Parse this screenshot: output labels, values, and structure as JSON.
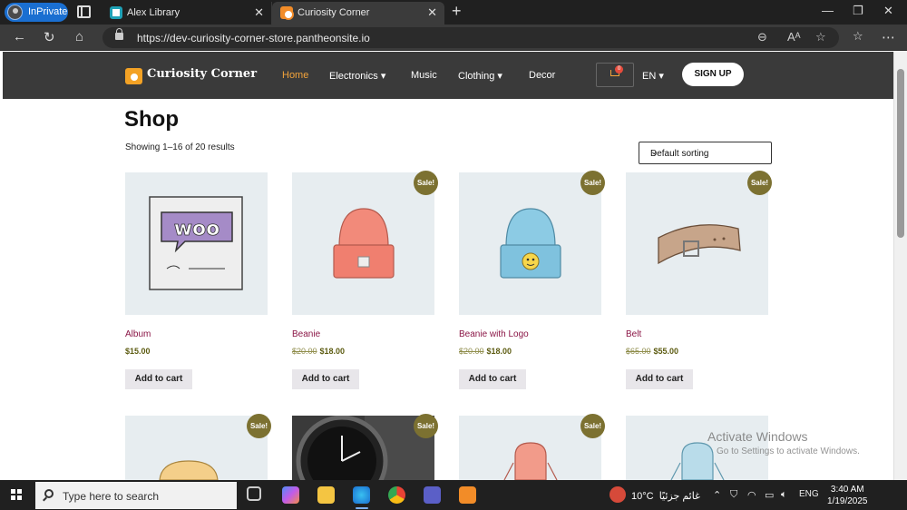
{
  "browser": {
    "inprivate_label": "InPrivate",
    "tabs": [
      {
        "title": "Alex Library",
        "active": false
      },
      {
        "title": "Curiosity Corner",
        "active": true
      }
    ],
    "url": "https://dev-curiosity-corner-store.pantheonsite.io"
  },
  "site": {
    "logo_text": "Curiosity Corner",
    "menu": [
      {
        "label": "Home",
        "active": true
      },
      {
        "label": "Electronics"
      },
      {
        "label": "Music"
      },
      {
        "label": "Clothing"
      },
      {
        "label": "Decor"
      }
    ],
    "cart_count": "0",
    "language": "EN",
    "signup_label": "SIGN UP",
    "brand_color": "#f2a33a",
    "header_bg": "#3a3a3a"
  },
  "shop": {
    "title": "Shop",
    "result_count": "Showing 1–16 of 20 results",
    "sorting": "Default sorting",
    "sale_label": "Sale!",
    "add_to_cart_label": "Add to cart",
    "products": [
      {
        "name": "Album",
        "price": "$15.00",
        "sale": false,
        "icon": "album-image"
      },
      {
        "name": "Beanie",
        "old_price": "$20.00",
        "price": "$18.00",
        "sale": true,
        "icon": "beanie-image"
      },
      {
        "name": "Beanie with Logo",
        "old_price": "$20.00",
        "price": "$18.00",
        "sale": true,
        "icon": "beanie-logo-image"
      },
      {
        "name": "Belt",
        "old_price": "$65.00",
        "price": "$55.00",
        "sale": true,
        "icon": "belt-image"
      }
    ],
    "second_row": [
      {
        "sale": true,
        "icon": "cap-image"
      },
      {
        "sale": true,
        "icon": "watch-image"
      },
      {
        "sale": true,
        "icon": "hoodie-image"
      },
      {
        "sale": false,
        "icon": "hoodie-image"
      }
    ]
  },
  "watermark": {
    "title": "Activate Windows",
    "subtitle": "Go to Settings to activate Windows."
  },
  "taskbar": {
    "search_placeholder": "Type here to search",
    "weather_temp": "10°C",
    "weather_text": "غائم جزئيًا",
    "language": "ENG",
    "time": "3:40 AM",
    "date": "1/19/2025"
  }
}
